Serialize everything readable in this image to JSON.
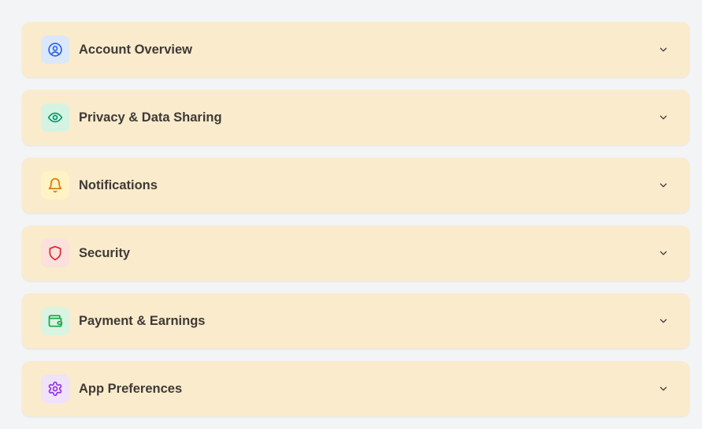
{
  "sections": [
    {
      "label": "Account Overview",
      "icon": "user-circle-icon",
      "icon_color": "#2563eb",
      "badge_bg": "#dbe8fb"
    },
    {
      "label": "Privacy & Data Sharing",
      "icon": "eye-icon",
      "icon_color": "#059669",
      "badge_bg": "#d5f3e3"
    },
    {
      "label": "Notifications",
      "icon": "bell-icon",
      "icon_color": "#d97706",
      "badge_bg": "#fdf3c4"
    },
    {
      "label": "Security",
      "icon": "shield-icon",
      "icon_color": "#dc2626",
      "badge_bg": "#fbe0dc"
    },
    {
      "label": "Payment & Earnings",
      "icon": "wallet-icon",
      "icon_color": "#16a34a",
      "badge_bg": "#d9f4e1"
    },
    {
      "label": "App Preferences",
      "icon": "gear-icon",
      "icon_color": "#9333ea",
      "badge_bg": "#efe2f9"
    }
  ],
  "chevron_icon": "chevron-down-icon",
  "colors": {
    "page_bg": "#f3f4f6",
    "card_bg": "#f9ebcc",
    "label_text": "#3f3a36",
    "chevron": "#4b4540"
  }
}
